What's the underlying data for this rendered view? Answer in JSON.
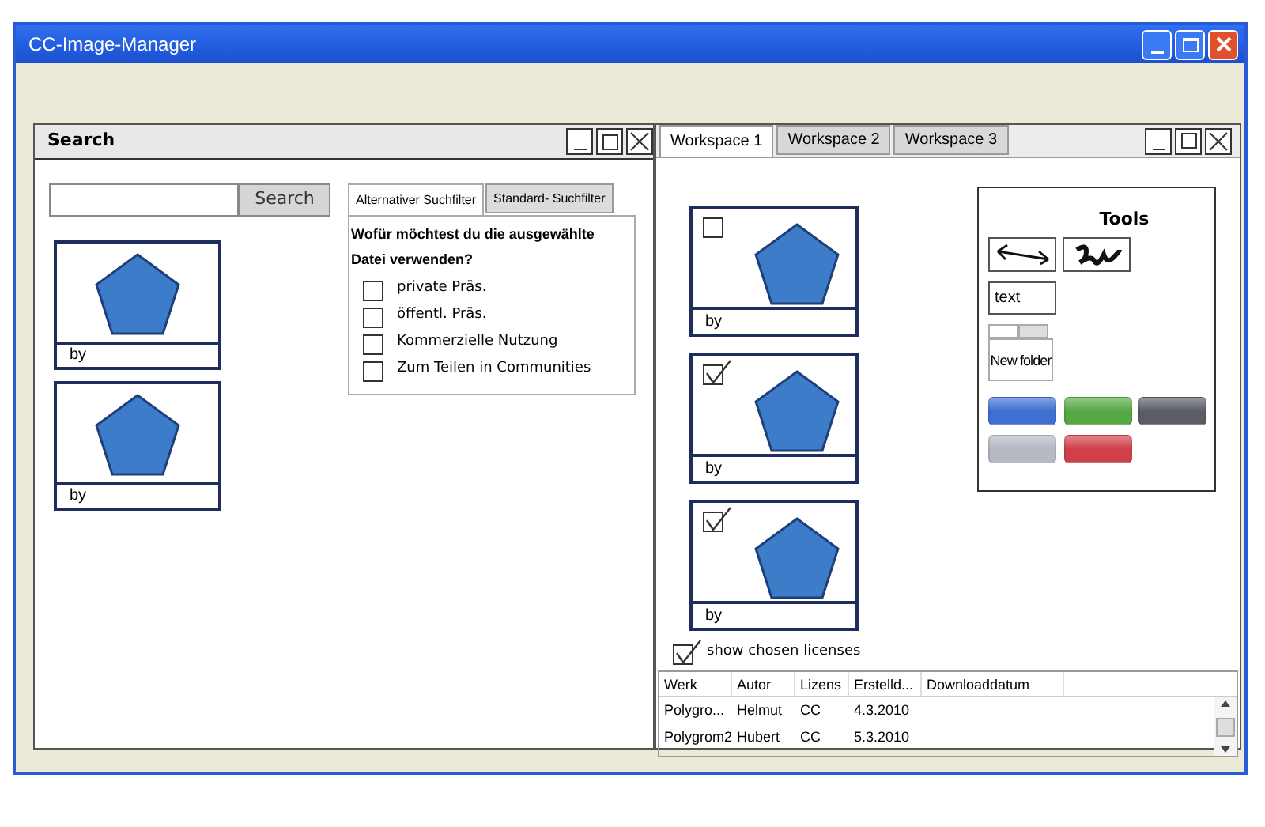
{
  "window": {
    "title": "CC-Image-Manager"
  },
  "search_panel": {
    "title": "Search",
    "search_button": "Search",
    "results": [
      {
        "caption": "by"
      },
      {
        "caption": "by"
      }
    ],
    "filter": {
      "tabs": [
        {
          "label": "Alternativer Suchfilter",
          "selected": true
        },
        {
          "label": "Standard- Suchfilter",
          "selected": false
        }
      ],
      "question": "Wofür möchtest du die ausgewählte Datei verwenden?",
      "options": [
        {
          "label": "private Präs.",
          "checked": false
        },
        {
          "label": "öffentl. Präs.",
          "checked": false
        },
        {
          "label": "Kommerzielle Nutzung",
          "checked": false
        },
        {
          "label": "Zum Teilen in Communities",
          "checked": false
        }
      ]
    }
  },
  "workspace": {
    "tabs": [
      {
        "label": "Workspace 1",
        "selected": true
      },
      {
        "label": "Workspace 2",
        "selected": false
      },
      {
        "label": "Workspace 3",
        "selected": false
      }
    ],
    "cards": [
      {
        "checked": false,
        "caption": "by"
      },
      {
        "checked": true,
        "caption": "by"
      },
      {
        "checked": true,
        "caption": "by"
      }
    ],
    "tools": {
      "title": "Tools",
      "text_tool": "text",
      "folder": "New folder",
      "swatches": [
        {
          "color": "#3f6fd0"
        },
        {
          "color": "#56a844"
        },
        {
          "color": "#5a5d66"
        },
        {
          "color": "#b4b9c3"
        },
        {
          "color": "#d0404a"
        }
      ]
    },
    "show_licenses": {
      "label": "show chosen licenses",
      "checked": true
    },
    "table": {
      "columns": [
        "Werk",
        "Autor",
        "Lizens",
        "Erstelld...",
        "Downloaddatum"
      ],
      "rows": [
        [
          "Polygro...",
          "Helmut",
          "CC",
          "4.3.2010"
        ],
        [
          "Polygrom2",
          "Hubert",
          "CC",
          "5.3.2010"
        ]
      ]
    }
  }
}
